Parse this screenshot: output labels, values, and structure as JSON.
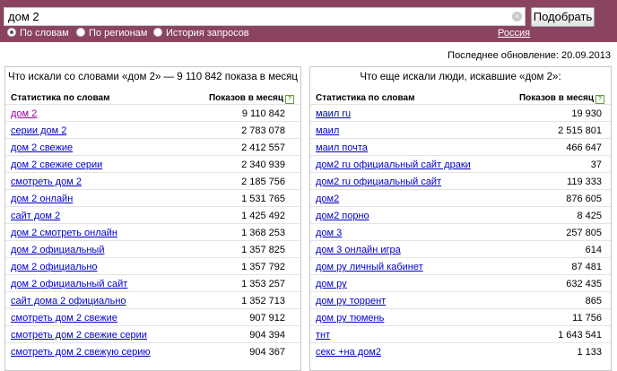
{
  "search": {
    "query": "дом 2",
    "button_label": "Подобрать"
  },
  "modes": [
    {
      "label": "По словам",
      "selected": true
    },
    {
      "label": "По регионам",
      "selected": false
    },
    {
      "label": "История запросов",
      "selected": false
    }
  ],
  "region_label": "Россия",
  "last_updated": "Последнее обновление: 20.09.2013",
  "left_panel": {
    "title": "Что искали со словами «дом 2» — 9 110 842 показа в месяц",
    "col_keyword": "Статистика по словам",
    "col_count": "Показов в месяц",
    "rows": [
      {
        "kw": "дом 2",
        "count": "9 110 842"
      },
      {
        "kw": "серии дом 2",
        "count": "2 783 078"
      },
      {
        "kw": "дом 2 свежие",
        "count": "2 412 557"
      },
      {
        "kw": "дом 2 свежие серии",
        "count": "2 340 939"
      },
      {
        "kw": "смотреть дом 2",
        "count": "2 185 756"
      },
      {
        "kw": "дом 2 онлайн",
        "count": "1 531 765"
      },
      {
        "kw": "сайт дом 2",
        "count": "1 425 492"
      },
      {
        "kw": "дом 2 смотреть онлайн",
        "count": "1 368 253"
      },
      {
        "kw": "дом 2 официальный",
        "count": "1 357 825"
      },
      {
        "kw": "дом 2 официально",
        "count": "1 357 792"
      },
      {
        "kw": "дом 2 официальный сайт",
        "count": "1 353 257"
      },
      {
        "kw": "сайт дома 2 официально",
        "count": "1 352 713"
      },
      {
        "kw": "смотреть дом 2 свежие",
        "count": "907 912"
      },
      {
        "kw": "смотреть дом 2 свежие серии",
        "count": "904 394"
      },
      {
        "kw": "смотреть дом 2 свежую серию",
        "count": "904 367"
      }
    ]
  },
  "right_panel": {
    "title": "Что еще искали люди, искавшие «дом 2»:",
    "col_keyword": "Статистика по словам",
    "col_count": "Показов в месяц",
    "rows": [
      {
        "kw": "маил ru",
        "count": "19 930"
      },
      {
        "kw": "маил",
        "count": "2 515 801"
      },
      {
        "kw": "маил почта",
        "count": "466 647"
      },
      {
        "kw": "дом2 ru официальный сайт драки",
        "count": "37"
      },
      {
        "kw": "дом2 ru официальный сайт",
        "count": "119 333"
      },
      {
        "kw": "дом2",
        "count": "876 605"
      },
      {
        "kw": "дом2 порно",
        "count": "8 425"
      },
      {
        "kw": "дом 3",
        "count": "257 805"
      },
      {
        "kw": "дом 3 онлайн игра",
        "count": "614"
      },
      {
        "kw": "дом ру личный кабинет",
        "count": "87 481"
      },
      {
        "kw": "дом ру",
        "count": "632 435"
      },
      {
        "kw": "дом ру торрент",
        "count": "865"
      },
      {
        "kw": "дом ру тюмень",
        "count": "11 756"
      },
      {
        "kw": "тнт",
        "count": "1 643 541"
      },
      {
        "kw": "секс +на дом2",
        "count": "1 133"
      }
    ]
  }
}
